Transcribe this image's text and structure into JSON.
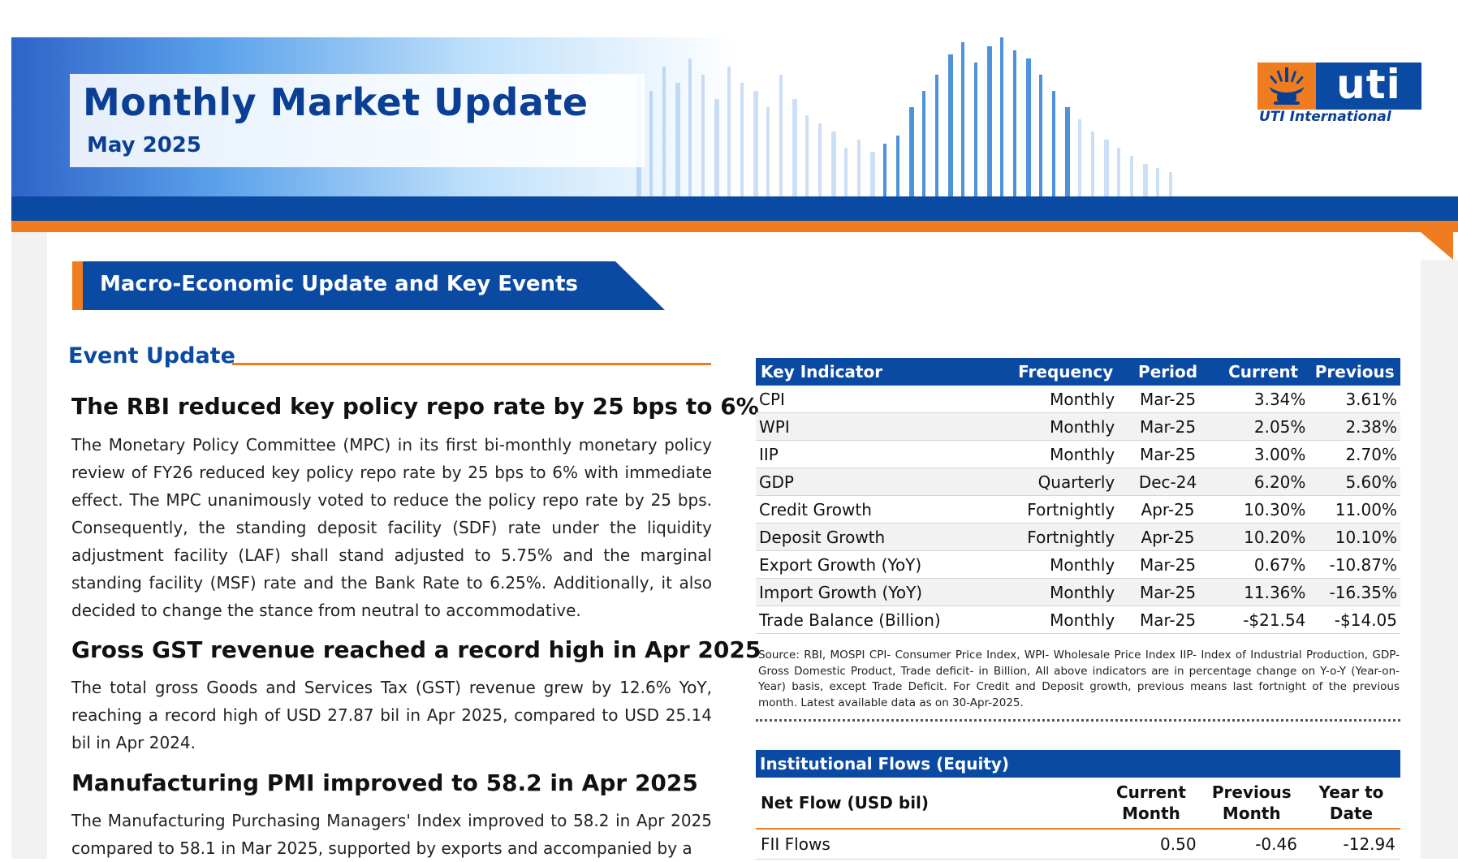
{
  "header": {
    "title": "Monthly Market Update",
    "subtitle": "May 2025",
    "logo_word": "uti",
    "logo_sub": "UTI International"
  },
  "section": {
    "title": "Macro-Economic Update and Key Events"
  },
  "event_update": {
    "heading": "Event Update",
    "items": [
      {
        "title": "The RBI reduced key policy repo rate by 25 bps to 6%",
        "body": "The Monetary Policy Committee (MPC) in its first bi-monthly monetary policy review of FY26 reduced key policy repo rate by 25 bps to 6% with immediate effect. The MPC unanimously voted to reduce the policy repo rate by 25 bps. Consequently, the standing deposit facility (SDF) rate under the liquidity adjustment facility (LAF) shall stand adjusted to 5.75% and the marginal standing facility (MSF) rate and the Bank Rate to 6.25%. Additionally, it also decided to change the stance from neutral to accommodative."
      },
      {
        "title": "Gross GST revenue reached a record high in Apr 2025",
        "body": "The total gross Goods and Services Tax (GST) revenue grew by 12.6% YoY, reaching a record high of USD 27.87 bil in Apr 2025, compared to USD 25.14 bil in Apr 2024."
      },
      {
        "title": "Manufacturing PMI improved to 58.2 in Apr 2025",
        "body": "The Manufacturing Purchasing Managers' Index improved to 58.2 in Apr 2025 compared to 58.1 in Mar 2025, supported by exports and accompanied by a"
      }
    ]
  },
  "indicators": {
    "headers": [
      "Key Indicator",
      "Frequency",
      "Period",
      "Current",
      "Previous"
    ],
    "rows": [
      [
        "CPI",
        "Monthly",
        "Mar-25",
        "3.34%",
        "3.61%"
      ],
      [
        "WPI",
        "Monthly",
        "Mar-25",
        "2.05%",
        "2.38%"
      ],
      [
        "IIP",
        "Monthly",
        "Mar-25",
        "3.00%",
        "2.70%"
      ],
      [
        "GDP",
        "Quarterly",
        "Dec-24",
        "6.20%",
        "5.60%"
      ],
      [
        "Credit Growth",
        "Fortnightly",
        "Apr-25",
        "10.30%",
        "11.00%"
      ],
      [
        "Deposit Growth",
        "Fortnightly",
        "Apr-25",
        "10.20%",
        "10.10%"
      ],
      [
        "Export Growth (YoY)",
        "Monthly",
        "Mar-25",
        "0.67%",
        "-10.87%"
      ],
      [
        "Import Growth (YoY)",
        "Monthly",
        "Mar-25",
        "11.36%",
        "-16.35%"
      ],
      [
        "Trade Balance (Billion)",
        "Monthly",
        "Mar-25",
        "-$21.54",
        "-$14.05"
      ]
    ],
    "source_note": "Source: RBI, MOSPI   CPI- Consumer Price Index, WPI- Wholesale Price Index IIP- Index of Industrial Production, GDP- Gross Domestic Product, Trade deficit- in Billion, All above indicators are in percentage change on Y-o-Y (Year-on-Year) basis, except Trade Deficit. For Credit and Deposit growth, previous means last fortnight of the previous month. Latest available data as on 30-Apr-2025."
  },
  "flows": {
    "title": "Institutional Flows (Equity)",
    "headers": {
      "label": "Net Flow (USD bil)",
      "current_1": "Current",
      "current_2": "Month",
      "previous_1": "Previous",
      "previous_2": "Month",
      "ytd_1": "Year to",
      "ytd_2": "Date"
    },
    "rows": [
      {
        "label": "FII Flows",
        "current": "0.50",
        "previous": "-0.46",
        "ytd": "-12.94"
      }
    ]
  },
  "colors": {
    "brand_blue": "#0b4aa2",
    "title_blue": "#0b3f94",
    "accent_orange": "#ef7c1e"
  },
  "icons": [
    "lamp-emblem-icon"
  ]
}
